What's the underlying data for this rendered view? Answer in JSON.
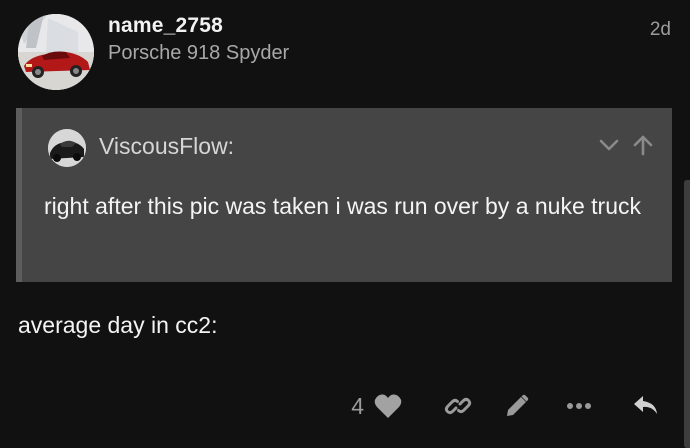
{
  "post": {
    "username": "name_2758",
    "user_title": "Porsche 918 Spyder",
    "date": "2d",
    "quote": {
      "author": "ViscousFlow:",
      "text": "right after this pic was taken i was run over by a nuke truck"
    },
    "body": "average day in cc2:",
    "like_count": "4"
  },
  "icons": {
    "expand": "chevron-down-icon",
    "jump": "arrow-up-icon",
    "like": "heart-icon",
    "share": "link-icon",
    "edit": "pencil-icon",
    "more": "ellipsis-icon",
    "reply": "reply-icon"
  },
  "colors": {
    "background": "#111111",
    "quote_background": "#454545",
    "muted_text": "#9c9c9c"
  }
}
